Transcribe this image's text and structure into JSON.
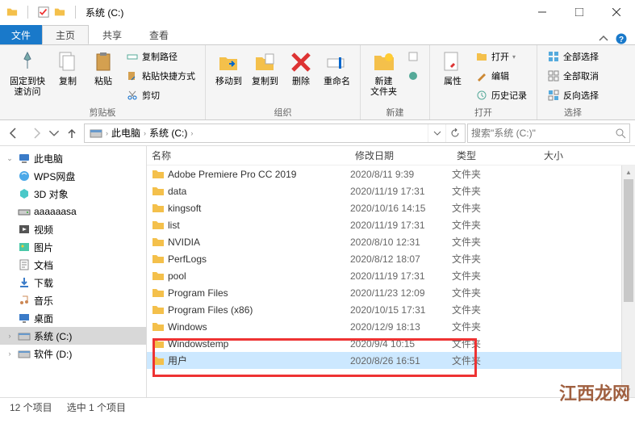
{
  "window": {
    "title": "系统 (C:)"
  },
  "tabs": {
    "file": "文件",
    "home": "主页",
    "share": "共享",
    "view": "查看"
  },
  "ribbon": {
    "clipboard": {
      "pin": "固定到快\n速访问",
      "copy": "复制",
      "paste": "粘贴",
      "copypath": "复制路径",
      "pasteshortcut": "粘贴快捷方式",
      "cut": "剪切",
      "label": "剪贴板"
    },
    "organize": {
      "moveto": "移动到",
      "copyto": "复制到",
      "delete": "删除",
      "rename": "重命名",
      "label": "组织"
    },
    "new": {
      "newfolder": "新建\n文件夹",
      "label": "新建"
    },
    "open": {
      "properties": "属性",
      "open": "打开",
      "edit": "编辑",
      "history": "历史记录",
      "label": "打开"
    },
    "select": {
      "selectall": "全部选择",
      "selectnone": "全部取消",
      "invert": "反向选择",
      "label": "选择"
    }
  },
  "breadcrumb": {
    "pc": "此电脑",
    "drive": "系统 (C:)"
  },
  "search": {
    "placeholder": "搜索\"系统 (C:)\""
  },
  "sidebar": {
    "items": [
      {
        "label": "此电脑",
        "icon": "pc",
        "arrow": "open"
      },
      {
        "label": "WPS网盘",
        "icon": "wps"
      },
      {
        "label": "3D 对象",
        "icon": "3d"
      },
      {
        "label": "aaaaaasa",
        "icon": "drive"
      },
      {
        "label": "视频",
        "icon": "video"
      },
      {
        "label": "图片",
        "icon": "pictures"
      },
      {
        "label": "文档",
        "icon": "docs"
      },
      {
        "label": "下载",
        "icon": "download"
      },
      {
        "label": "音乐",
        "icon": "music"
      },
      {
        "label": "桌面",
        "icon": "desktop"
      },
      {
        "label": "系统 (C:)",
        "icon": "disk",
        "selected": true
      },
      {
        "label": "软件 (D:)",
        "icon": "disk"
      }
    ]
  },
  "columns": {
    "name": "名称",
    "date": "修改日期",
    "type": "类型",
    "size": "大小"
  },
  "files": [
    {
      "name": "Adobe Premiere Pro CC 2019",
      "date": "2020/8/11 9:39",
      "type": "文件夹"
    },
    {
      "name": "data",
      "date": "2020/11/19 17:31",
      "type": "文件夹"
    },
    {
      "name": "kingsoft",
      "date": "2020/10/16 14:15",
      "type": "文件夹"
    },
    {
      "name": "list",
      "date": "2020/11/19 17:31",
      "type": "文件夹"
    },
    {
      "name": "NVIDIA",
      "date": "2020/8/10 12:31",
      "type": "文件夹"
    },
    {
      "name": "PerfLogs",
      "date": "2020/8/12 18:07",
      "type": "文件夹"
    },
    {
      "name": "pool",
      "date": "2020/11/19 17:31",
      "type": "文件夹"
    },
    {
      "name": "Program Files",
      "date": "2020/11/23 12:09",
      "type": "文件夹"
    },
    {
      "name": "Program Files (x86)",
      "date": "2020/10/15 17:31",
      "type": "文件夹"
    },
    {
      "name": "Windows",
      "date": "2020/12/9 18:13",
      "type": "文件夹"
    },
    {
      "name": "Windowstemp",
      "date": "2020/9/4 10:15",
      "type": "文件夹"
    },
    {
      "name": "用户",
      "date": "2020/8/26 16:51",
      "type": "文件夹",
      "selected": true
    }
  ],
  "status": {
    "count": "12 个项目",
    "selected": "选中 1 个项目"
  },
  "watermark": "江西龙网"
}
